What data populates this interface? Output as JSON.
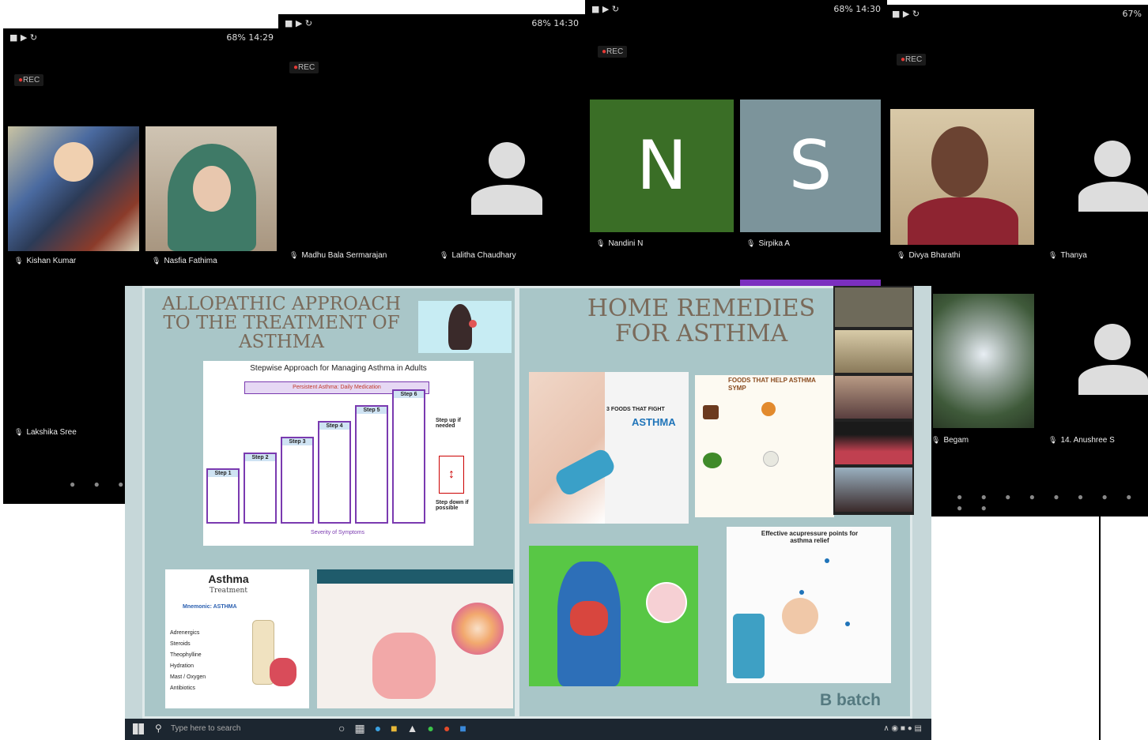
{
  "screen1": {
    "status_right": "68% 14:29",
    "rec_label": "REC",
    "participants": [
      "Kishan Kumar",
      "Nasfia Fathima",
      "Lakshika Sree"
    ]
  },
  "screen2": {
    "status_right": "68% 14:30",
    "rec_label": "REC",
    "participants": [
      "Madhu Bala Sermarajan",
      "Lalitha Chaudhary"
    ]
  },
  "screen3": {
    "status_right": "68% 14:30",
    "rec_label": "REC",
    "participants": [
      "Nandini N",
      "Sirpika A"
    ],
    "avatar_letters": [
      "N",
      "S"
    ],
    "colors": {
      "tile_n": "#3a6e26",
      "tile_s": "#7c949b"
    }
  },
  "screen4": {
    "status_right": "67%",
    "rec_label": "REC",
    "participants": [
      "Divya Bharathi",
      "Thanya",
      "Begam",
      "14. Anushree S"
    ]
  },
  "slide_left": {
    "title_lines": [
      "ALLOPATHIC APPROACH",
      "TO THE TREATMENT OF",
      "ASTHMA"
    ],
    "chart_title": "Stepwise Approach for Managing Asthma in Adults",
    "persistent_label": "Persistent Asthma: Daily Medication",
    "steps": [
      "Step 1",
      "Step 2",
      "Step 3",
      "Step 4",
      "Step 5",
      "Step 6"
    ],
    "step_up": "Step up if needed",
    "step_down": "Step down if possible",
    "severity": "Severity of Symptoms",
    "asthma_card": {
      "title": "Asthma",
      "subtitle": "Treatment",
      "mnemonic": "Mnemonic: ASTHMA",
      "items": [
        "Adrenergics",
        "Steroids",
        "Theophylline",
        "Hydration",
        "Mast / Oxygen",
        "Antibiotics"
      ]
    }
  },
  "slide_right": {
    "title_lines": [
      "HOME REMEDIES",
      "FOR ASTHMA"
    ],
    "foods_card": {
      "header": "3 FOODS THAT FIGHT",
      "highlight": "ASTHMA"
    },
    "foods_help": "FOODS THAT HELP ASTHMA SYMP",
    "acupressure": "Effective acupressure points for asthma relief",
    "batch": "B batch"
  },
  "taskbar": {
    "search_placeholder": "Type here to search"
  },
  "colors": {
    "slide_bg": "#a9c6c8",
    "title": "#7a6a5a",
    "accent_blue": "#1f74b9",
    "taskbar": "#1c2630"
  }
}
